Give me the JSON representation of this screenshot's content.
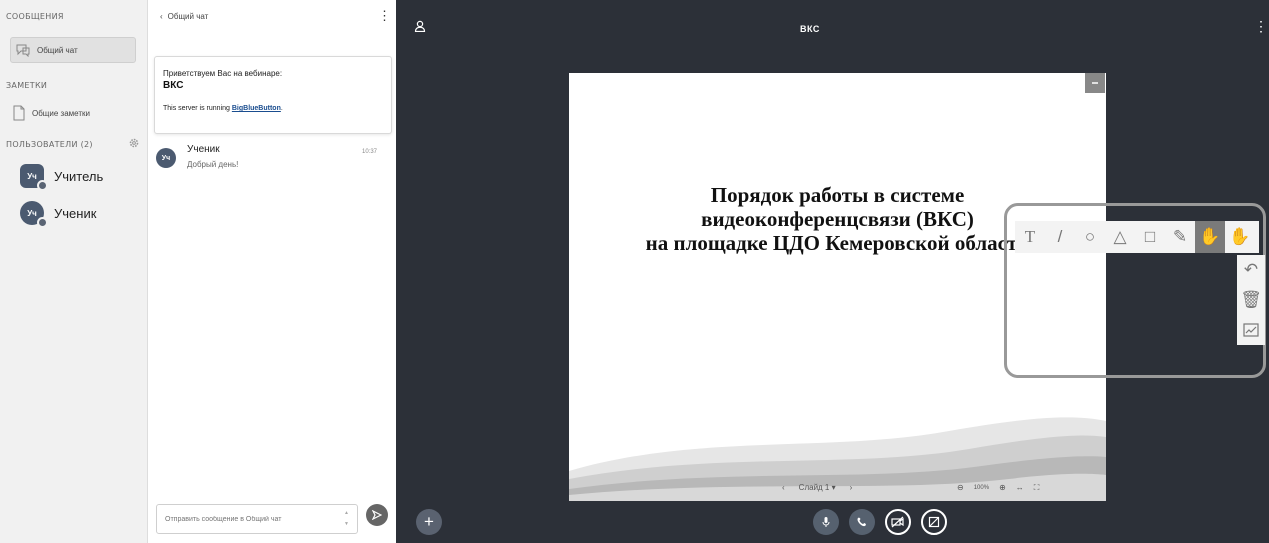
{
  "sidebar": {
    "messages_title": "СООБЩЕНИЯ",
    "public_chat": "Общий чат",
    "notes_title": "ЗАМЕТКИ",
    "shared_notes": "Общие заметки",
    "users_title": "ПОЛЬЗОВАТЕЛИ (2)",
    "users": [
      {
        "initials": "Уч",
        "name": "Учитель"
      },
      {
        "initials": "Уч",
        "name": "Ученик"
      }
    ]
  },
  "chat": {
    "back_label": "Общий чат",
    "welcome_line1": "Приветствуем Вас на вебинаре:",
    "welcome_line2": "ВКС",
    "server_prefix": "This server is running ",
    "server_link": "BigBlueButton",
    "server_suffix": ".",
    "message": {
      "initials": "Уч",
      "sender": "Ученик",
      "time": "10:37",
      "text": "Добрый день!"
    },
    "input_placeholder": "Отправить сообщение в Общий чат"
  },
  "main": {
    "title": "ВКС",
    "slide_lines": [
      "Порядок работы в системе",
      "видеоконференцсвязи (ВКС)",
      "на площадке ЦДО  Кемеровской области"
    ],
    "slide_nav_label": "Слайд 1",
    "zoom_level": "100%"
  },
  "icons": {
    "tools_row": [
      "text-tool-icon",
      "line-tool-icon",
      "ellipse-tool-icon",
      "triangle-tool-icon",
      "rectangle-tool-icon",
      "pencil-tool-icon",
      "hand-tool-icon"
    ],
    "tools_col": [
      "undo-icon",
      "trash-icon",
      "multi-user-whiteboard-icon"
    ]
  },
  "colors": {
    "main_bg": "#2c3038",
    "sidebar_bg": "#f1f1f1",
    "link": "#1a4d8f"
  }
}
